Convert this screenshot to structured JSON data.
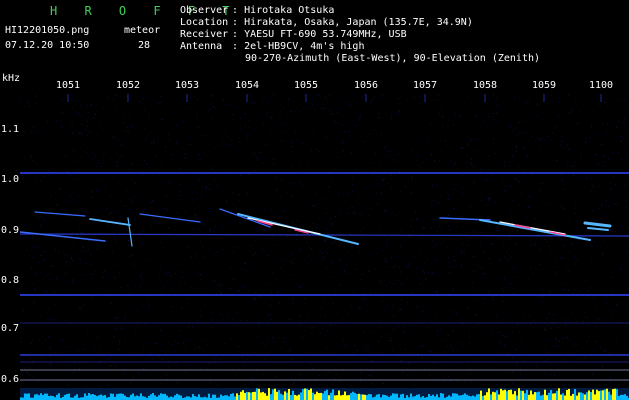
{
  "header": {
    "brand": "H R O F F T",
    "filename": "HI12201050.png",
    "mode": "meteor",
    "datetime": "07.12.20 10:50",
    "count": "28"
  },
  "info": {
    "observer_label": "Observer",
    "observer": "Hirotaka Otsuka",
    "location_label": "Location",
    "location": "Hirakata, Osaka, Japan (135.7E, 34.9N)",
    "receiver_label": "Receiver",
    "receiver": "YAESU FT-690 53.749MHz, USB",
    "antenna_label": "Antenna",
    "antenna_line1": "2el-HB9CV, 4m's high",
    "antenna_line2": "90-270-Azimuth (East-West), 90-Elevation (Zenith)",
    "separator": ":"
  },
  "axis": {
    "unit": "kHz",
    "time_ticks": [
      "1051",
      "1052",
      "1053",
      "1054",
      "1055",
      "1056",
      "1057",
      "1058",
      "1059",
      "1100"
    ],
    "freq_ticks": [
      "1.1",
      "1.0",
      "0.9",
      "0.8",
      "0.7",
      "0.6"
    ]
  },
  "colors": {
    "background": "#000000",
    "noise": "#0a1450",
    "carrier": "#3448ff",
    "trail": "#56b6ff",
    "trail_hot": "#ff3c96",
    "brand": "#41d05a",
    "signal_bar": "#ffff00",
    "noise_bar": "#00b7ff"
  }
}
